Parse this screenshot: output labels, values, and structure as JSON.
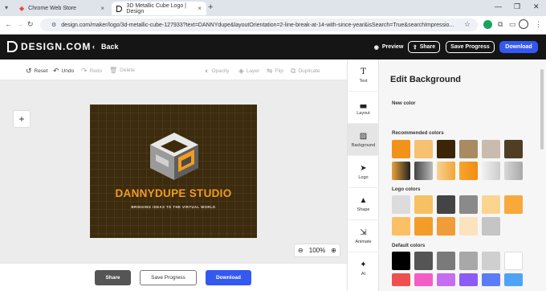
{
  "browser": {
    "tabs": [
      {
        "label": "Chrome Web Store"
      },
      {
        "label": "3D Metallic Cube Logo | Design"
      }
    ],
    "url": "design.com/maker/logo/3d-metallic-cube-127933?text=DANNYdupe&layoutOrientation=2-line-break-at-14-with-since-year&isSearch=True&searchImpressio..."
  },
  "header": {
    "brand": "DESIGN.COM",
    "back_label": "Back",
    "preview_label": "Preview",
    "share_label": "Share",
    "save_label": "Save Progress",
    "download_label": "Download"
  },
  "toolbar": {
    "reset": "Reset",
    "undo": "Undo",
    "redo": "Redo",
    "delete": "Delete",
    "opacity": "Opacity",
    "layer": "Layer",
    "flip": "Flip",
    "duplicate": "Duplicate"
  },
  "canvas": {
    "brand_text": "DANNYDUPE STUDIO",
    "tagline": "BRINGING IDEAS TO THE VIRTUAL WORLD",
    "zoom": "100%",
    "bg_color": "#3d2b0e"
  },
  "bottom": {
    "share_label": "Share",
    "save_label": "Save Progress",
    "download_label": "Download"
  },
  "tools": [
    {
      "label": "Text",
      "icon": "text-icon"
    },
    {
      "label": "Layout",
      "icon": "layout-icon"
    },
    {
      "label": "Background",
      "icon": "background-icon"
    },
    {
      "label": "Logo",
      "icon": "logo-icon"
    },
    {
      "label": "Shape",
      "icon": "shape-icon"
    },
    {
      "label": "Animate",
      "icon": "animate-icon"
    },
    {
      "label": "AI",
      "icon": "ai-icon"
    }
  ],
  "panel": {
    "title": "Edit Background",
    "new_color_label": "New color",
    "recommended_label": "Recommended colors",
    "logo_colors_label": "Logo colors",
    "default_colors_label": "Default colors",
    "recommended_row1": [
      "#f3921b",
      "#f6c170",
      "#3b2507",
      "#a88a63",
      "#c9bcae",
      "#4f3d24"
    ],
    "recommended_row2": [
      "linear-gradient(90deg,#e9a23b,#222)",
      "linear-gradient(90deg,#444,#bbb)",
      "linear-gradient(90deg,#f7d296,#f3a533)",
      "linear-gradient(90deg,#f7a52e,#f38c12)",
      "linear-gradient(90deg,#f2f2f2,#ccc)",
      "linear-gradient(90deg,#d8d8d8,#a8a8a8)"
    ],
    "logo_row1": [
      "#dcdcdc",
      "#f7c062",
      "#444444",
      "#8a8a8a",
      "#fbd58f",
      "#f8a93a"
    ],
    "logo_row2": [
      "#fbc065",
      "#f39d28",
      "#f09c37",
      "#fbe3bf",
      "#c5c5c5"
    ],
    "default_row1": [
      "#000000",
      "#555555",
      "#7a7a7a",
      "#a8a8a8",
      "#cfcfcf",
      "#ffffff"
    ],
    "default_row2": [
      "#f04f4f",
      "#f25ec6",
      "#c56cf0",
      "#8b5cf6",
      "#5b7cf5",
      "#4fa3f5"
    ]
  }
}
